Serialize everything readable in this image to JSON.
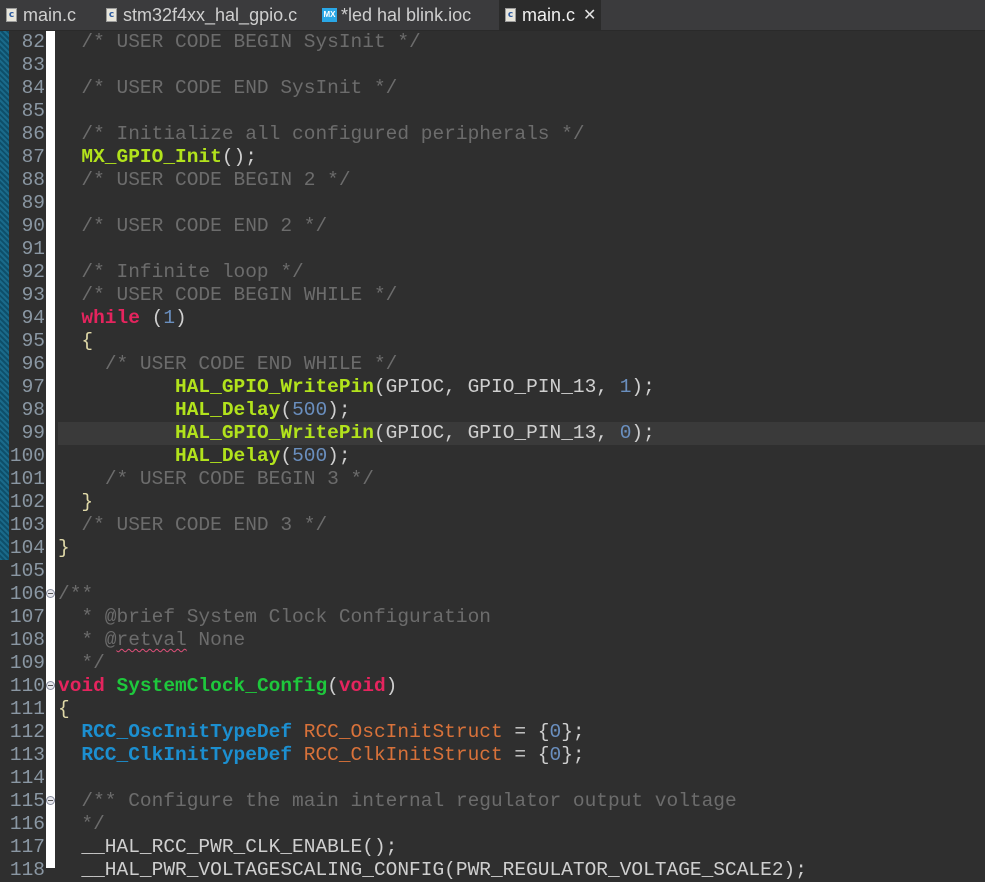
{
  "tabs": [
    {
      "label": "main.c",
      "icon": "c-file-icon",
      "active": false
    },
    {
      "label": "stm32f4xx_hal_gpio.c",
      "icon": "c-file-icon",
      "active": false
    },
    {
      "label": "*led hal blink.ioc",
      "icon": "mx-file-icon",
      "icon_text": "MX",
      "active": false
    },
    {
      "label": "main.c",
      "icon": "c-file-icon",
      "active": true,
      "close": "✕"
    }
  ],
  "colors": {
    "background": "#2f2f2f",
    "comment": "#6c6c6c",
    "keyword": "#e5245e",
    "function": "#b2e31c",
    "type": "#1c8fd0",
    "variable": "#d9723a",
    "number": "#6a8fbf"
  },
  "editor": {
    "current_line": 99,
    "lines": [
      {
        "n": "82",
        "t": [
          [
            "  ",
            ""
          ],
          [
            "/* USER CODE BEGIN SysInit */",
            "cm"
          ]
        ]
      },
      {
        "n": "83",
        "t": []
      },
      {
        "n": "84",
        "t": [
          [
            "  ",
            ""
          ],
          [
            "/* USER CODE END SysInit */",
            "cm"
          ]
        ]
      },
      {
        "n": "85",
        "t": []
      },
      {
        "n": "86",
        "t": [
          [
            "  ",
            ""
          ],
          [
            "/* Initialize all configured peripherals */",
            "cm"
          ]
        ]
      },
      {
        "n": "87",
        "t": [
          [
            "  ",
            ""
          ],
          [
            "MX_GPIO_Init",
            "fn"
          ],
          [
            "();",
            ""
          ]
        ]
      },
      {
        "n": "88",
        "t": [
          [
            "  ",
            ""
          ],
          [
            "/* USER CODE BEGIN 2 */",
            "cm"
          ]
        ]
      },
      {
        "n": "89",
        "t": []
      },
      {
        "n": "90",
        "t": [
          [
            "  ",
            ""
          ],
          [
            "/* USER CODE END 2 */",
            "cm"
          ]
        ]
      },
      {
        "n": "91",
        "t": []
      },
      {
        "n": "92",
        "t": [
          [
            "  ",
            ""
          ],
          [
            "/* Infinite loop */",
            "cm"
          ]
        ]
      },
      {
        "n": "93",
        "t": [
          [
            "  ",
            ""
          ],
          [
            "/* USER CODE BEGIN WHILE */",
            "cm"
          ]
        ]
      },
      {
        "n": "94",
        "t": [
          [
            "  ",
            ""
          ],
          [
            "while",
            "kw"
          ],
          [
            " (",
            ""
          ],
          [
            "1",
            "num"
          ],
          [
            ")",
            ""
          ]
        ]
      },
      {
        "n": "95",
        "t": [
          [
            "  ",
            ""
          ],
          [
            "{",
            "pn"
          ]
        ]
      },
      {
        "n": "96",
        "t": [
          [
            "    ",
            ""
          ],
          [
            "/* USER CODE END WHILE */",
            "cm"
          ]
        ]
      },
      {
        "n": "97",
        "t": [
          [
            "          ",
            ""
          ],
          [
            "HAL_GPIO_WritePin",
            "fn"
          ],
          [
            "(GPIOC, GPIO_PIN_13, ",
            ""
          ],
          [
            "1",
            "num"
          ],
          [
            ");",
            ""
          ]
        ]
      },
      {
        "n": "98",
        "t": [
          [
            "          ",
            ""
          ],
          [
            "HAL_Delay",
            "fn"
          ],
          [
            "(",
            ""
          ],
          [
            "500",
            "num"
          ],
          [
            ");",
            ""
          ]
        ]
      },
      {
        "n": "99",
        "t": [
          [
            "          ",
            ""
          ],
          [
            "HAL_GPIO_WritePin",
            "fn"
          ],
          [
            "(GPIOC, GPIO_PIN_13, ",
            ""
          ],
          [
            "0",
            "num"
          ],
          [
            ");",
            ""
          ]
        ]
      },
      {
        "n": "100",
        "t": [
          [
            "          ",
            ""
          ],
          [
            "HAL_Delay",
            "fn"
          ],
          [
            "(",
            ""
          ],
          [
            "500",
            "num"
          ],
          [
            ");",
            ""
          ]
        ]
      },
      {
        "n": "101",
        "t": [
          [
            "    ",
            ""
          ],
          [
            "/* USER CODE BEGIN 3 */",
            "cm"
          ]
        ]
      },
      {
        "n": "102",
        "t": [
          [
            "  ",
            ""
          ],
          [
            "}",
            "pn"
          ]
        ]
      },
      {
        "n": "103",
        "t": [
          [
            "  ",
            ""
          ],
          [
            "/* USER CODE END 3 */",
            "cm"
          ]
        ]
      },
      {
        "n": "104",
        "t": [
          [
            "}",
            "pn"
          ]
        ]
      },
      {
        "n": "105",
        "t": []
      },
      {
        "n": "106",
        "fold": true,
        "t": [
          [
            "/**",
            "cm"
          ]
        ]
      },
      {
        "n": "107",
        "t": [
          [
            "  * @brief System Clock Configuration",
            "cm"
          ]
        ]
      },
      {
        "n": "108",
        "t": [
          [
            "  * @",
            "cm"
          ],
          [
            "retval",
            "cm sq"
          ],
          [
            " None",
            "cm"
          ]
        ]
      },
      {
        "n": "109",
        "t": [
          [
            "  */",
            "cm"
          ]
        ]
      },
      {
        "n": "110",
        "fold": true,
        "t": [
          [
            "void",
            "kw"
          ],
          [
            " ",
            ""
          ],
          [
            "SystemClock_Config",
            "fd"
          ],
          [
            "(",
            ""
          ],
          [
            "void",
            "kw"
          ],
          [
            ")",
            ""
          ]
        ]
      },
      {
        "n": "111",
        "t": [
          [
            "{",
            "pn"
          ]
        ]
      },
      {
        "n": "112",
        "t": [
          [
            "  ",
            ""
          ],
          [
            "RCC_OscInitTypeDef",
            "ty"
          ],
          [
            " ",
            ""
          ],
          [
            "RCC_OscInitStruct",
            "var"
          ],
          [
            " = {",
            ""
          ],
          [
            "0",
            "num"
          ],
          [
            "};",
            ""
          ]
        ]
      },
      {
        "n": "113",
        "t": [
          [
            "  ",
            ""
          ],
          [
            "RCC_ClkInitTypeDef",
            "ty"
          ],
          [
            " ",
            ""
          ],
          [
            "RCC_ClkInitStruct",
            "var"
          ],
          [
            " = {",
            ""
          ],
          [
            "0",
            "num"
          ],
          [
            "};",
            ""
          ]
        ]
      },
      {
        "n": "114",
        "t": []
      },
      {
        "n": "115",
        "fold": true,
        "t": [
          [
            "  ",
            ""
          ],
          [
            "/** Configure the main internal regulator output voltage",
            "cm"
          ]
        ]
      },
      {
        "n": "116",
        "t": [
          [
            "  */",
            "cm"
          ]
        ]
      },
      {
        "n": "117",
        "t": [
          [
            "  __HAL_RCC_PWR_CLK_ENABLE();",
            ""
          ]
        ]
      },
      {
        "n": "118",
        "t": [
          [
            "  __HAL_PWR_VOLTAGESCALING_CONFIG(PWR_REGULATOR_VOLTAGE_SCALE2);",
            ""
          ]
        ]
      }
    ]
  }
}
